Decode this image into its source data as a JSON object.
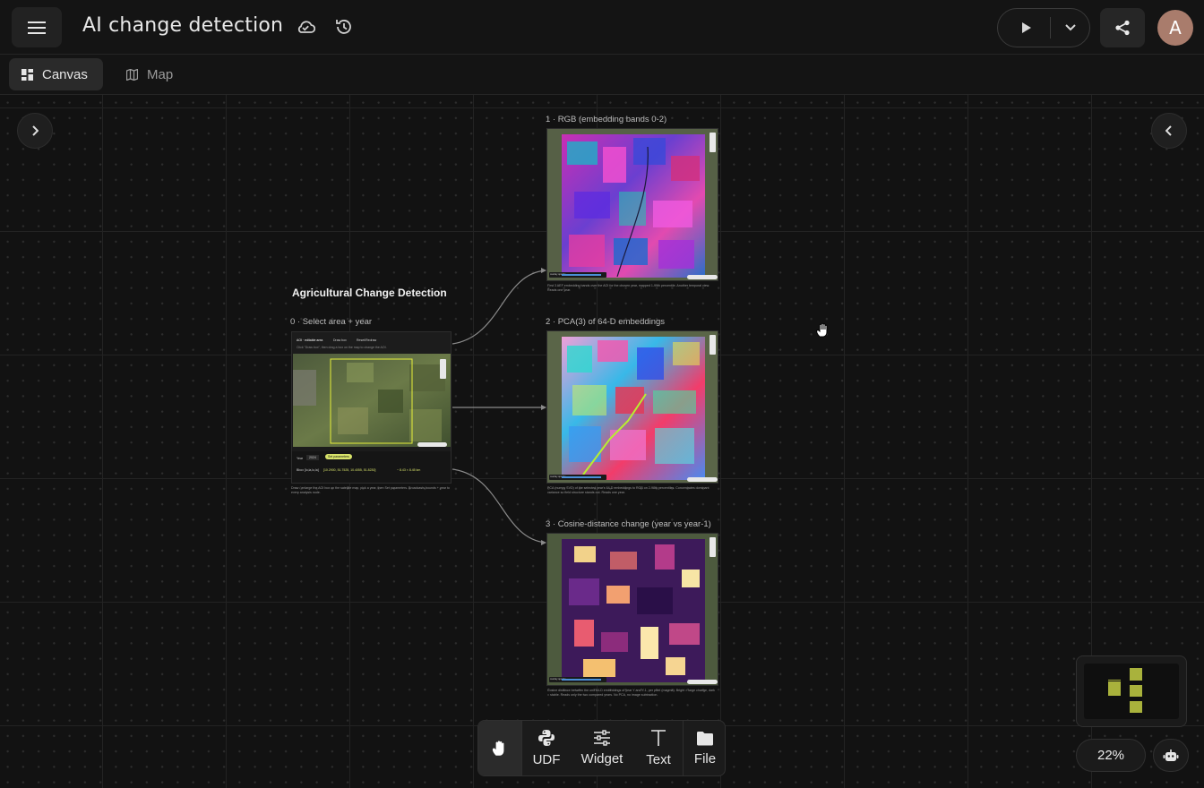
{
  "header": {
    "title": "AI change detection",
    "menu_icon": "hamburger-menu-icon",
    "cloud_icon": "cloud-check-icon",
    "history_icon": "history-icon",
    "avatar_initial": "A"
  },
  "tabs": [
    {
      "label": "Canvas",
      "icon": "grid-icon",
      "active": true
    },
    {
      "label": "Map",
      "icon": "map-icon",
      "active": false
    }
  ],
  "canvas": {
    "heading": "Agricultural Change Detection",
    "nodes": [
      {
        "label": "0 · Select area + year",
        "mini_tabs": [
          "AOI · editable area",
          "Draw box",
          "Reset/Redraw"
        ],
        "mini_hint": "Click \"Draw box\", then drag a box on the map to change the AOI.",
        "year_label": "Year",
        "year_value": "2024",
        "apply_button": "Set parameters",
        "bbox_label": "Bbox [lo,la,lo,la]",
        "bbox_value": "[10.2900, 51.7525, 10.4055, 51.8230]",
        "area_value": "~ 8.43 × 8.45 km",
        "caption": "Draw / enlarge the AOI box on the satellite map, pick a year, then Set parameters. Broadcasts bounds + year to every analysis node."
      },
      {
        "label": "1 · RGB (embedding bands 0-2)",
        "opacity_label": "overlay opacity",
        "caption": "First 3 AEF embedding bands over the AOI for the chosen year, mapped 1-99th percentile. Another temporal view. Reads one year."
      },
      {
        "label": "2 · PCA(3) of 64-D embeddings",
        "opacity_label": "overlay opacity",
        "caption": "PCA (numpy SVD) of the selected year's 64-D embeddings to RGB on 2-98th percentiles. Concentrates dominant variance so field structure stands out. Reads one year."
      },
      {
        "label": "3 · Cosine-distance change (year vs year-1)",
        "opacity_label": "overlay opacity",
        "caption": "Cosine distance between the unit 64-D embeddings of year Y and Y-1, per pixel (magma). Bright = large change, dark = stable. Reads only the two compared years. No PCA, no image subtraction."
      }
    ]
  },
  "toolbar": {
    "items": [
      {
        "label": "",
        "icon": "hand-icon",
        "active": true
      },
      {
        "label": "UDF",
        "icon": "python-icon"
      },
      {
        "label": "Widget",
        "icon": "sliders-icon"
      },
      {
        "label": "Text",
        "icon": "text-icon"
      },
      {
        "label": "File",
        "icon": "folder-icon"
      }
    ]
  },
  "zoom": {
    "level": "22%"
  },
  "colors": {
    "background": "#121212",
    "accent_yellow": "#d8e36a",
    "minimap_block": "#a9b23c",
    "avatar": "#a97c6c"
  }
}
